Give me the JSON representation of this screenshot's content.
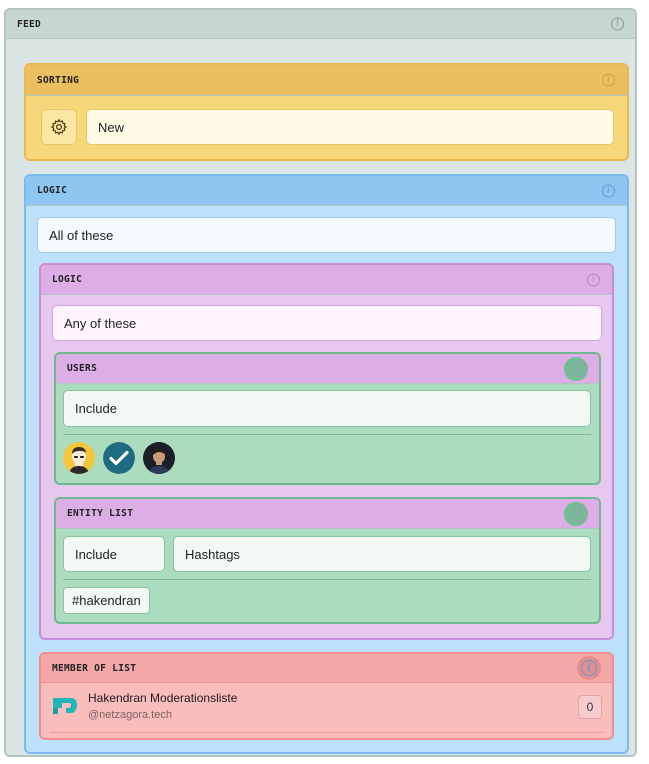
{
  "feed": {
    "title": "FEED"
  },
  "sorting": {
    "title": "SORTING",
    "value": "New",
    "icon": "gear-icon"
  },
  "logic_outer": {
    "title": "LOGIC",
    "value": "All of these"
  },
  "logic_inner": {
    "title": "LOGIC",
    "value": "Any of these"
  },
  "users": {
    "title": "USERS",
    "mode": "Include",
    "avatars": [
      "user-avatar-1",
      "user-avatar-2-check",
      "user-avatar-3"
    ]
  },
  "entity_list": {
    "title": "ENTITY LIST",
    "mode": "Include",
    "type": "Hashtags",
    "tags": [
      "#hakendran"
    ]
  },
  "member_of_list": {
    "title": "MEMBER OF LIST",
    "list_name": "Hakendran Moderationsliste",
    "list_handle": "@netzagora.tech",
    "count": "0"
  },
  "colors": {
    "feed": "#dbe6e4",
    "sorting": "#f6d77a",
    "logic_outer": "#bde0fb",
    "logic_inner": "#e6c8ee",
    "green": "#abdcbe",
    "member": "#fbbcbc"
  }
}
